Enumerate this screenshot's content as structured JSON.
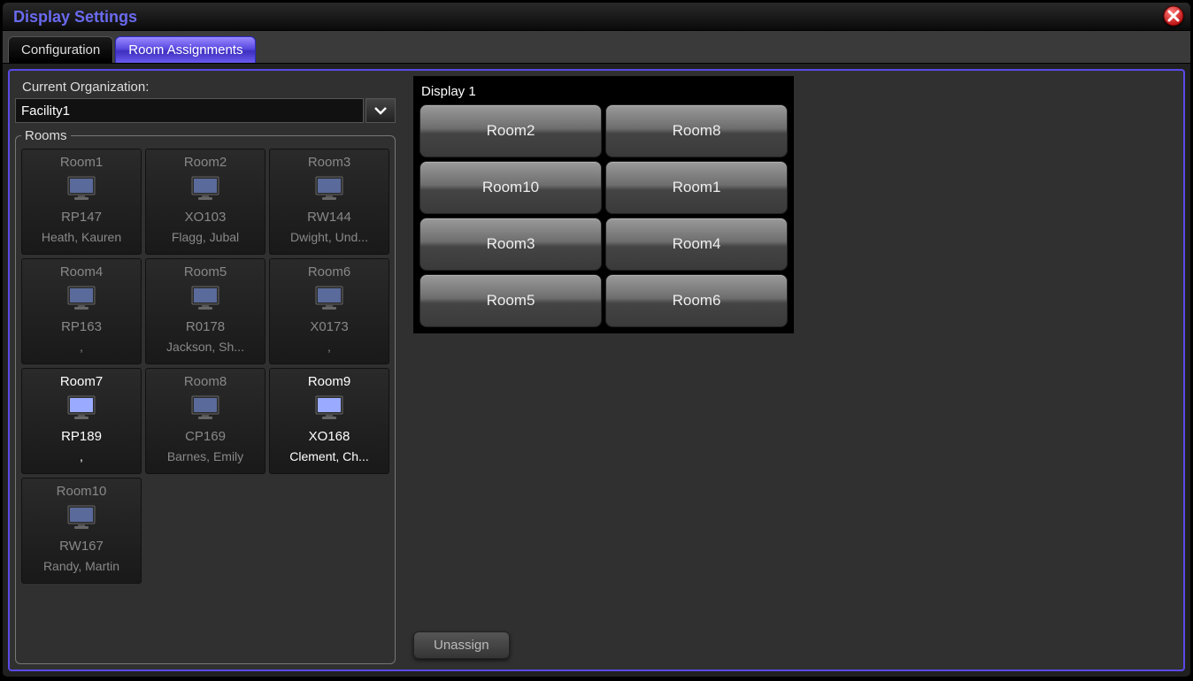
{
  "window": {
    "title": "Display Settings"
  },
  "tabs": [
    "Configuration",
    "Room Assignments"
  ],
  "activeTab": 1,
  "org": {
    "label": "Current Organization:",
    "value": "Facility1"
  },
  "roomsLegend": "Rooms",
  "rooms": [
    {
      "name": "Room1",
      "code": "RP147",
      "person": "Heath, Kauren",
      "bright": false
    },
    {
      "name": "Room2",
      "code": "XO103",
      "person": "Flagg, Jubal",
      "bright": false
    },
    {
      "name": "Room3",
      "code": "RW144",
      "person": "Dwight, Und...",
      "bright": false
    },
    {
      "name": "Room4",
      "code": "RP163",
      "person": ",",
      "bright": false
    },
    {
      "name": "Room5",
      "code": "R0178",
      "person": "Jackson, Sh...",
      "bright": false
    },
    {
      "name": "Room6",
      "code": "X0173",
      "person": ",",
      "bright": false
    },
    {
      "name": "Room7",
      "code": "RP189",
      "person": ",",
      "bright": true
    },
    {
      "name": "Room8",
      "code": "CP169",
      "person": "Barnes, Emily",
      "bright": false
    },
    {
      "name": "Room9",
      "code": "XO168",
      "person": "Clement, Ch...",
      "bright": true
    },
    {
      "name": "Room10",
      "code": "RW167",
      "person": "Randy, Martin",
      "bright": false
    }
  ],
  "display": {
    "title": "Display 1",
    "slots": [
      "Room2",
      "Room8",
      "Room10",
      "Room1",
      "Room3",
      "Room4",
      "Room5",
      "Room6"
    ]
  },
  "buttons": {
    "unassign": "Unassign"
  }
}
